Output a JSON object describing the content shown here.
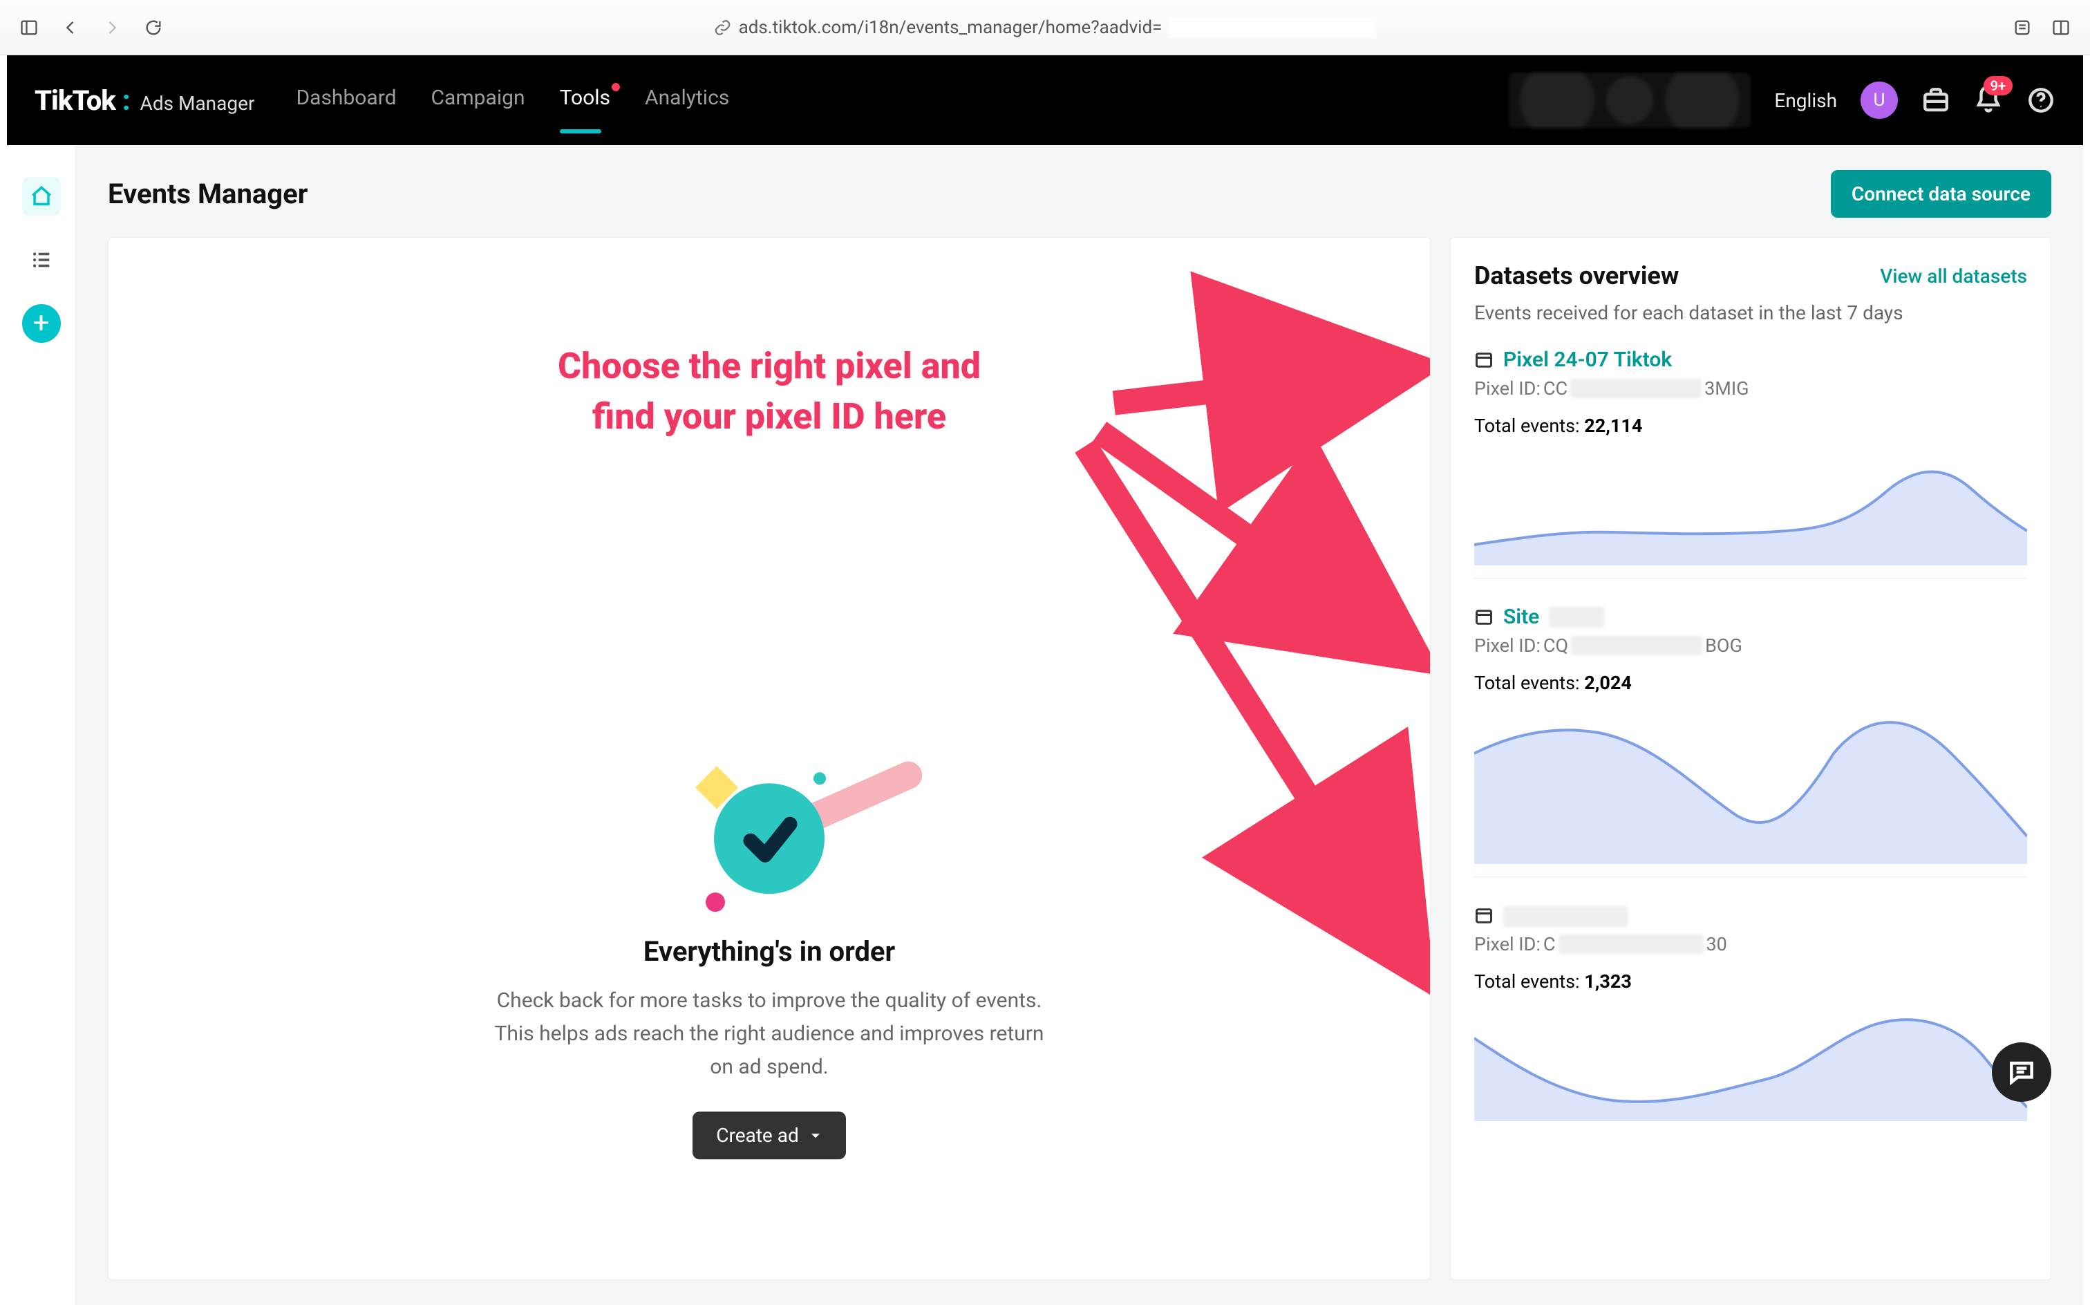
{
  "browser": {
    "url": "ads.tiktok.com/i18n/events_manager/home?aadvid="
  },
  "app": {
    "brand_primary": "TikTok",
    "brand_secondary": "Ads Manager",
    "nav": {
      "dashboard": "Dashboard",
      "campaign": "Campaign",
      "tools": "Tools",
      "analytics": "Analytics"
    },
    "language": "English",
    "avatar_initial": "U",
    "notification_badge": "9+"
  },
  "page": {
    "title": "Events Manager",
    "connect_button": "Connect data source"
  },
  "annotation": {
    "line1": "Choose the right pixel and",
    "line2": "find your pixel ID here"
  },
  "empty_state": {
    "title": "Everything's in order",
    "description": "Check back for more tasks to improve the quality of events.\nThis helps ads reach the right audience and improves return\non ad spend.",
    "cta": "Create ad"
  },
  "datasets": {
    "title": "Datasets overview",
    "view_all": "View all datasets",
    "subtitle": "Events received for each dataset in the last 7 days",
    "pixel_id_label": "Pixel ID: ",
    "total_events_label": "Total events: ",
    "items": [
      {
        "name": "Pixel 24-07 Tiktok",
        "pixel_prefix": "CC",
        "pixel_suffix": "3MIG",
        "total": "22,114"
      },
      {
        "name": "Site",
        "pixel_prefix": "CQ",
        "pixel_suffix": "BOG",
        "total": "2,024"
      },
      {
        "name": "",
        "pixel_prefix": "C",
        "pixel_suffix": "30",
        "total": "1,323"
      }
    ]
  },
  "chart_data": [
    {
      "type": "area",
      "title": "Pixel 24-07 Tiktok — events last 7 days",
      "x": [
        1,
        2,
        3,
        4,
        5,
        6,
        7
      ],
      "values": [
        1800,
        2400,
        2200,
        2400,
        2600,
        6800,
        4200
      ],
      "ylim": [
        0,
        8000
      ]
    },
    {
      "type": "area",
      "title": "Site — events last 7 days",
      "x": [
        1,
        2,
        3,
        4,
        5,
        6,
        7
      ],
      "values": [
        340,
        380,
        260,
        200,
        360,
        400,
        200
      ],
      "ylim": [
        0,
        450
      ]
    },
    {
      "type": "area",
      "title": "Dataset 3 — events last 7 days",
      "x": [
        1,
        2,
        3,
        4,
        5,
        6,
        7
      ],
      "values": [
        260,
        140,
        120,
        160,
        300,
        320,
        140
      ],
      "ylim": [
        0,
        350
      ]
    }
  ],
  "colors": {
    "accent": "#009995",
    "chart_stroke": "#7e9ee8",
    "chart_fill": "#dbe4fa",
    "annotation": "#ee3763"
  }
}
